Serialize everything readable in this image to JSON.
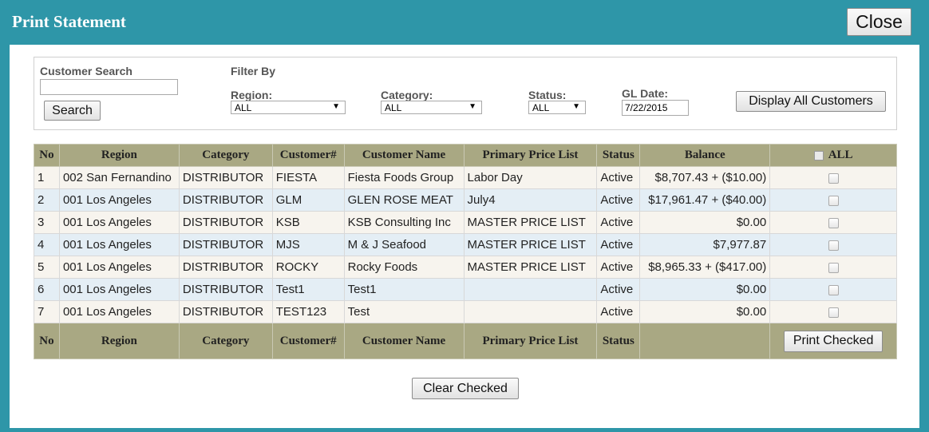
{
  "dialog": {
    "title": "Print Statement",
    "close_label": "Close"
  },
  "search": {
    "label": "Customer Search",
    "value": "",
    "button_label": "Search"
  },
  "filters": {
    "heading": "Filter By",
    "region": {
      "label": "Region:",
      "value": "ALL"
    },
    "category": {
      "label": "Category:",
      "value": "ALL"
    },
    "status": {
      "label": "Status:",
      "value": "ALL"
    },
    "gl_date": {
      "label": "GL Date:",
      "value": "7/22/2015"
    },
    "display_all_label": "Display All Customers"
  },
  "table": {
    "headers": [
      "No",
      "Region",
      "Category",
      "Customer#",
      "Customer Name",
      "Primary Price List",
      "Status",
      "Balance",
      "ALL"
    ],
    "footer_headers": [
      "No",
      "Region",
      "Category",
      "Customer#",
      "Customer Name",
      "Primary Price List",
      "Status"
    ],
    "rows": [
      [
        "1",
        "002 San Fernandino",
        "DISTRIBUTOR",
        "FIESTA",
        "Fiesta Foods Group",
        "Labor Day",
        "Active",
        "$8,707.43 + ($10.00)"
      ],
      [
        "2",
        "001 Los Angeles",
        "DISTRIBUTOR",
        "GLM",
        "GLEN ROSE MEAT",
        "July4",
        "Active",
        "$17,961.47 + ($40.00)"
      ],
      [
        "3",
        "001 Los Angeles",
        "DISTRIBUTOR",
        "KSB",
        "KSB Consulting Inc",
        "MASTER PRICE LIST",
        "Active",
        "$0.00"
      ],
      [
        "4",
        "001 Los Angeles",
        "DISTRIBUTOR",
        "MJS",
        "M & J Seafood",
        "MASTER PRICE LIST",
        "Active",
        "$7,977.87"
      ],
      [
        "5",
        "001 Los Angeles",
        "DISTRIBUTOR",
        "ROCKY",
        "Rocky Foods",
        "MASTER PRICE LIST",
        "Active",
        "$8,965.33 + ($417.00)"
      ],
      [
        "6",
        "001 Los Angeles",
        "DISTRIBUTOR",
        "Test1",
        "Test1",
        "",
        "Active",
        "$0.00"
      ],
      [
        "7",
        "001 Los Angeles",
        "DISTRIBUTOR",
        "TEST123",
        "Test",
        "",
        "Active",
        "$0.00"
      ]
    ]
  },
  "actions": {
    "print_checked_label": "Print Checked",
    "clear_checked_label": "Clear Checked"
  }
}
